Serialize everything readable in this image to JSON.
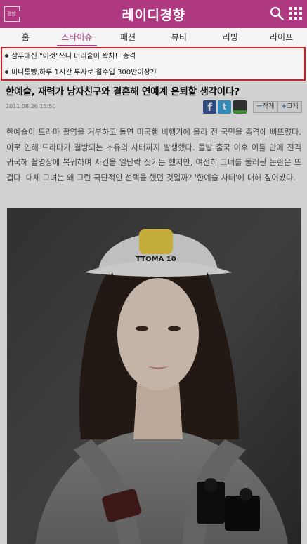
{
  "header": {
    "home_icon_label": "경향",
    "brand_title": "레이디경향",
    "icons": {
      "search": "search-icon",
      "menu": "grid-menu-icon"
    },
    "colors": {
      "header_bg": "#b03a82",
      "accent": "#b03a82",
      "highlight_border": "#e8151b"
    }
  },
  "nav": {
    "tabs": [
      {
        "label": "홈"
      },
      {
        "label": "스타이슈",
        "active": true
      },
      {
        "label": "패션"
      },
      {
        "label": "뷰티"
      },
      {
        "label": "리빙"
      },
      {
        "label": "라이프"
      }
    ]
  },
  "promos": [
    {
      "text": "샴푸대신 \"이것\"쓰니 머리숱이 꽉차!! 충격"
    },
    {
      "text": "미니통빵,하루 1시간 투자로 월수입 300만이상?!"
    }
  ],
  "article": {
    "title": "한예슬, 재력가 남자친구와 결혼해 연예계 은퇴할 생각이다?",
    "date": "2011.08.26 15:50",
    "share_icons": [
      "facebook-icon",
      "twitter-icon",
      "share-etc-icon"
    ],
    "font_size": {
      "smaller_label": "작게",
      "larger_label": "크게",
      "minus": "－",
      "plus": "+"
    },
    "body": "한예슬이 드라마 촬영을 거부하고 돌연 미국행 비행기에 올라 전 국민을 충격에 빠뜨렸다. 이로 인해 드라마가 결방되는 초유의 사태까지 발생했다. 돌발 출국 이후 이틀 만에 전격 귀국해 촬영장에 복귀하며 사건을 일단락 짓기는 했지만, 여전히 그녀를 둘러싼 논란은 뜨겁다. 대체 그녀는 왜 그런 극단적인 선택을 했던 것일까? '한예슬 사태'에 대해 짚어봤다.",
    "photo": {
      "cap_text": "TTOMA 10"
    }
  }
}
